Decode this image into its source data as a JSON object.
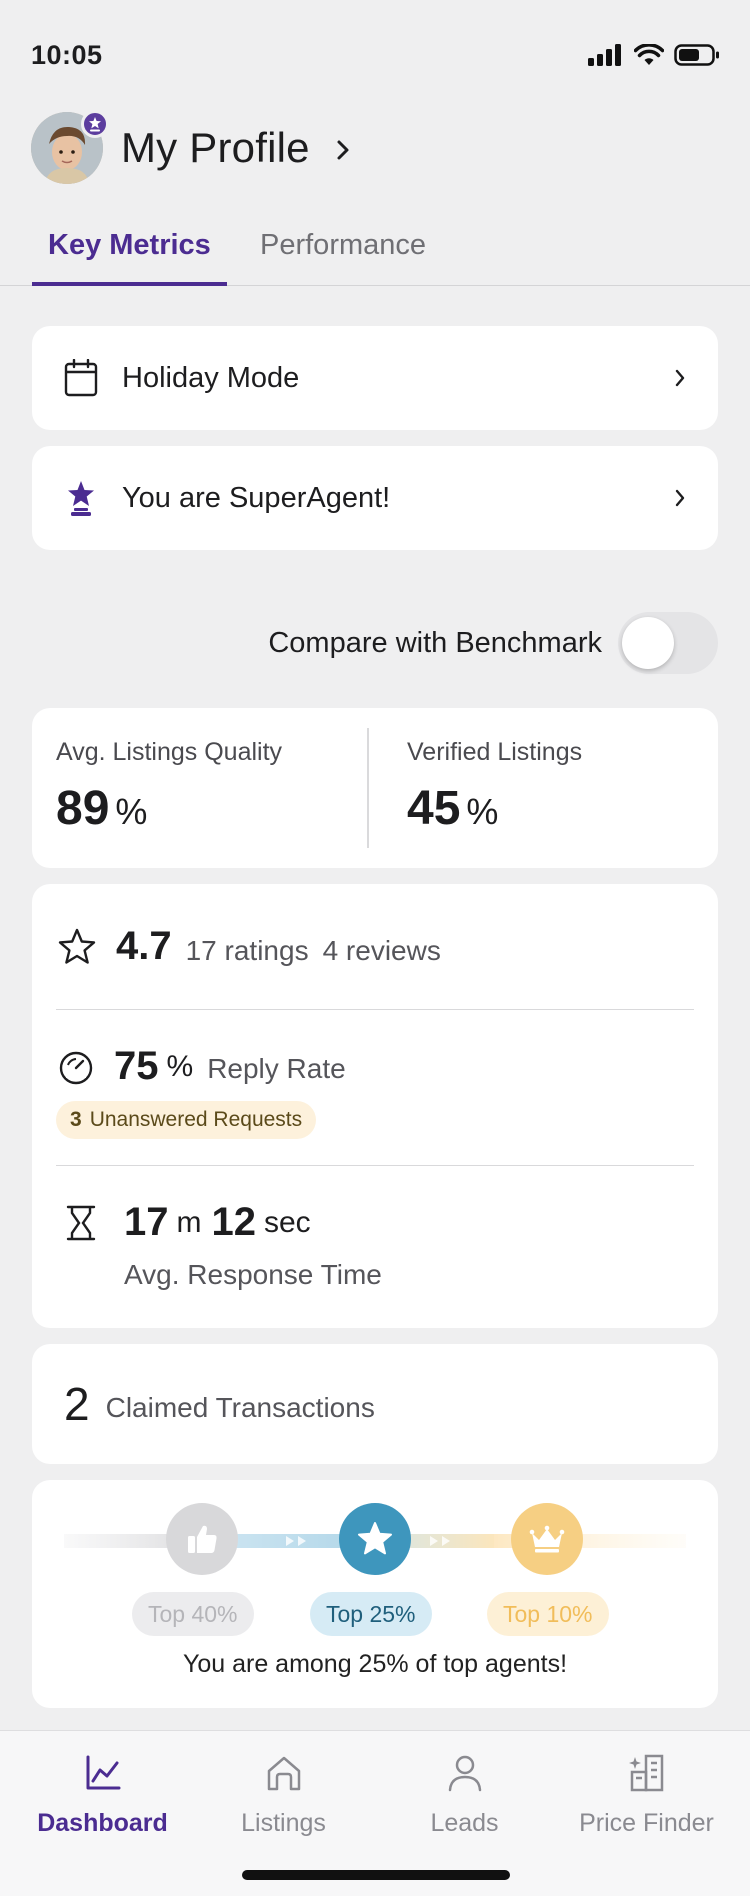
{
  "status_bar": {
    "time": "10:05"
  },
  "header": {
    "title": "My Profile"
  },
  "tabs": [
    {
      "label": "Key Metrics",
      "active": true
    },
    {
      "label": "Performance",
      "active": false
    }
  ],
  "menu": {
    "holiday_mode": "Holiday Mode",
    "superagent": "You are SuperAgent!"
  },
  "compare": {
    "label": "Compare with Benchmark",
    "enabled": false
  },
  "metrics": {
    "listings_quality": {
      "label": "Avg. Listings Quality",
      "value": "89",
      "unit": "%"
    },
    "verified_listings": {
      "label": "Verified Listings",
      "value": "45",
      "unit": "%"
    }
  },
  "rating": {
    "value": "4.7",
    "ratings": "17 ratings",
    "reviews": "4 reviews"
  },
  "reply": {
    "value": "75",
    "unit": "%",
    "label": "Reply Rate",
    "unanswered_count": "3",
    "unanswered_label": "Unanswered Requests"
  },
  "response_time": {
    "minutes": "17",
    "minutes_unit": "m",
    "seconds": "12",
    "seconds_unit": "sec",
    "label": "Avg. Response Time"
  },
  "claimed": {
    "count": "2",
    "label": "Claimed Transactions"
  },
  "tiers": {
    "items": [
      {
        "label": "Top 40%",
        "state": "inactive"
      },
      {
        "label": "Top 25%",
        "state": "current"
      },
      {
        "label": "Top 10%",
        "state": "locked"
      }
    ],
    "caption": "You are among 25% of top agents!"
  },
  "bottom_nav": [
    {
      "label": "Dashboard",
      "icon": "chart-line-icon",
      "active": true
    },
    {
      "label": "Listings",
      "icon": "home-icon",
      "active": false
    },
    {
      "label": "Leads",
      "icon": "person-icon",
      "active": false
    },
    {
      "label": "Price Finder",
      "icon": "building-sparkle-icon",
      "active": false
    }
  ],
  "colors": {
    "brand": "#4b2c91",
    "current_tier": "#3e96bd",
    "locked_tier": "#f6cf83",
    "pending_pill": "#fdf1dc"
  }
}
